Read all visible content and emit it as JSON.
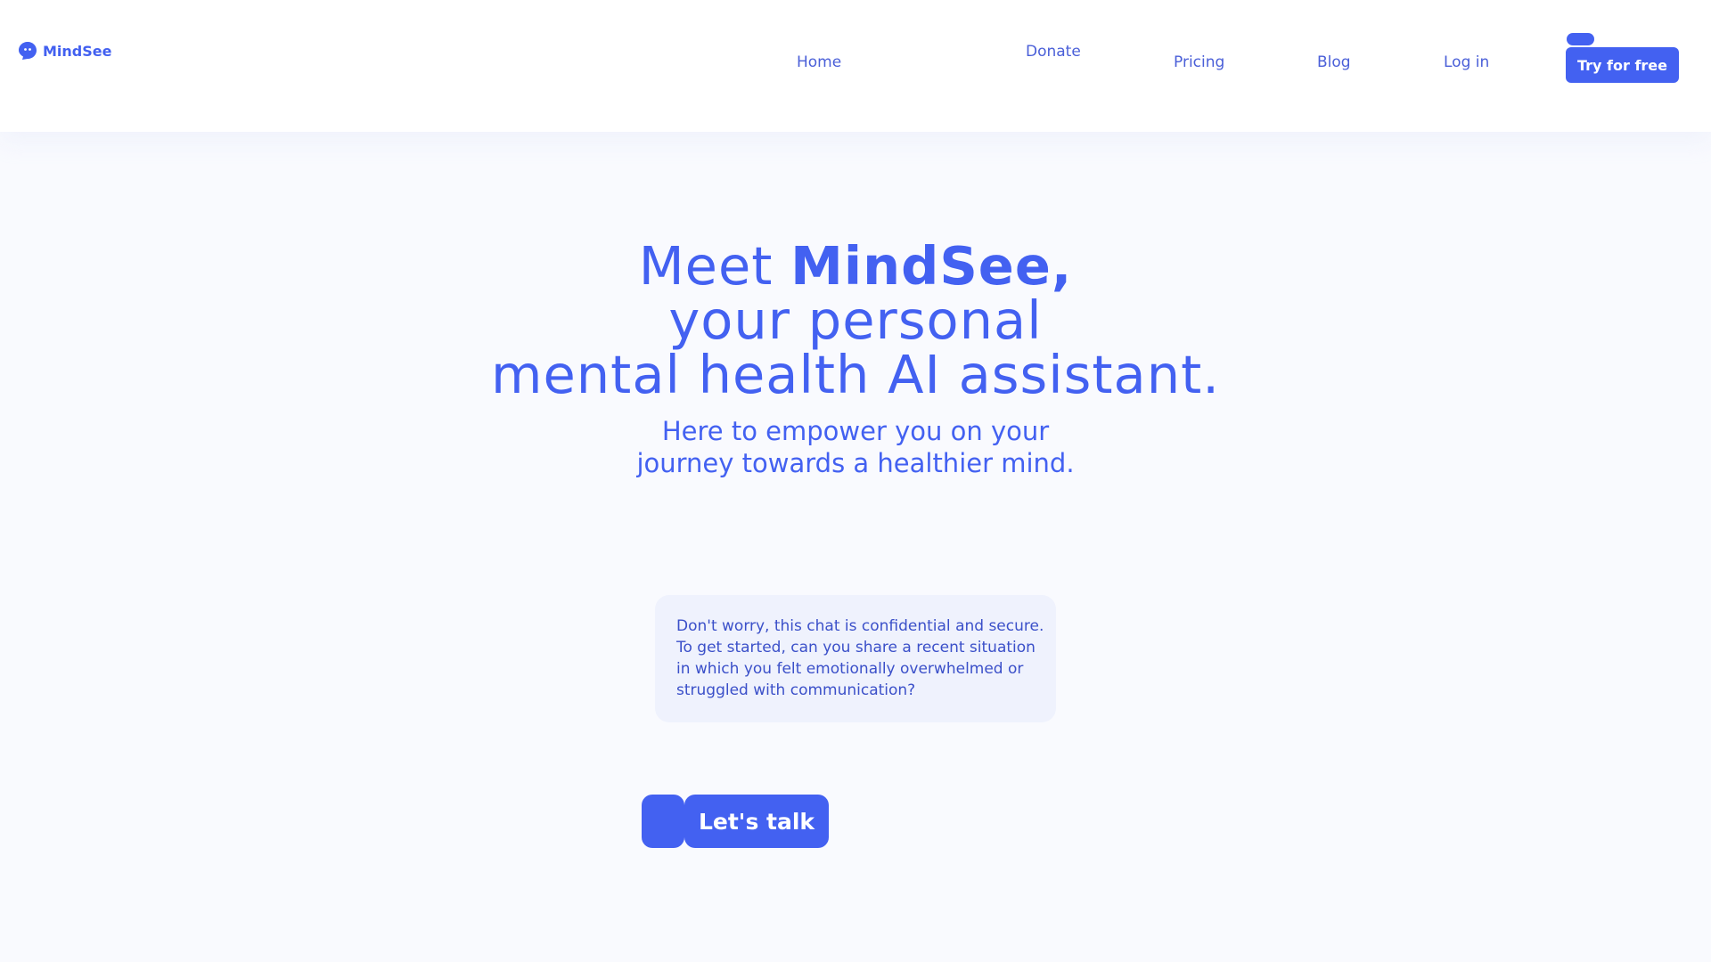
{
  "brand": {
    "name": "MindSee",
    "logo_icon": "chat-bubble-face-icon",
    "color": "#4361f1"
  },
  "nav": {
    "home": "Home",
    "donate": "Donate",
    "pricing": "Pricing",
    "blog": "Blog",
    "login": "Log in",
    "cta": "Try for free"
  },
  "hero": {
    "title_prefix": "Meet ",
    "title_brand": "MindSee,",
    "title_line2": "your personal",
    "title_line3": "mental health AI assistant.",
    "subtitle_line1": "Here to empower you on your",
    "subtitle_line2": "journey towards a healthier mind."
  },
  "chat": {
    "lines": [
      "Don't worry, this chat is confidential and secure.",
      "To get started, can you share a recent situation",
      "in which you felt emotionally overwhelmed or",
      "struggled with communication?"
    ]
  },
  "cta": {
    "talk_label": "Let's talk"
  },
  "colors": {
    "background": "#f9fafe",
    "accent": "#4361f1",
    "bubble": "#eff2fd"
  }
}
